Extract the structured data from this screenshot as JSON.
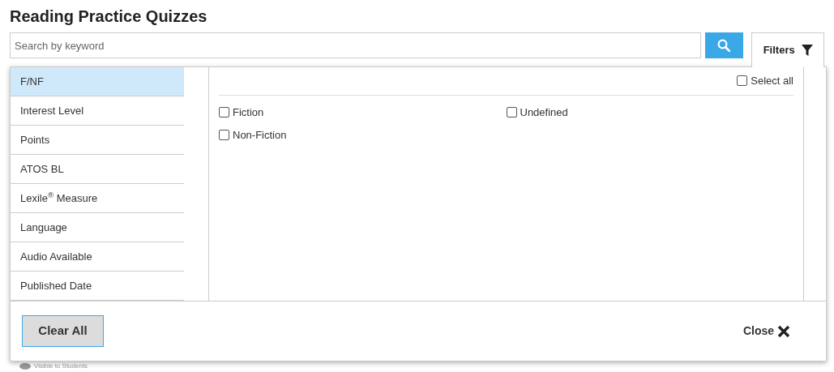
{
  "title": "Reading Practice Quizzes",
  "search": {
    "placeholder": "Search by keyword"
  },
  "filters_tab": {
    "label": "Filters",
    "selected": true
  },
  "categories": [
    {
      "label": "F/NF",
      "selected": true
    },
    {
      "label": "Interest Level",
      "selected": false
    },
    {
      "label": "Points",
      "selected": false
    },
    {
      "label": "ATOS BL",
      "selected": false
    },
    {
      "label": "Lexile$^{®}$ Measure",
      "selected": false
    },
    {
      "label": "Language",
      "selected": false
    },
    {
      "label": "Audio Available",
      "selected": false
    },
    {
      "label": "Published Date",
      "selected": false
    }
  ],
  "select_all": {
    "label": "Select all",
    "checked": false
  },
  "options": [
    {
      "label": "Fiction",
      "checked": false
    },
    {
      "label": "Undefined",
      "checked": false
    },
    {
      "label": "Non-Fiction",
      "checked": false
    }
  ],
  "buttons": {
    "clear": "Clear All",
    "close": "Close"
  },
  "background_text": "Visible to Students"
}
